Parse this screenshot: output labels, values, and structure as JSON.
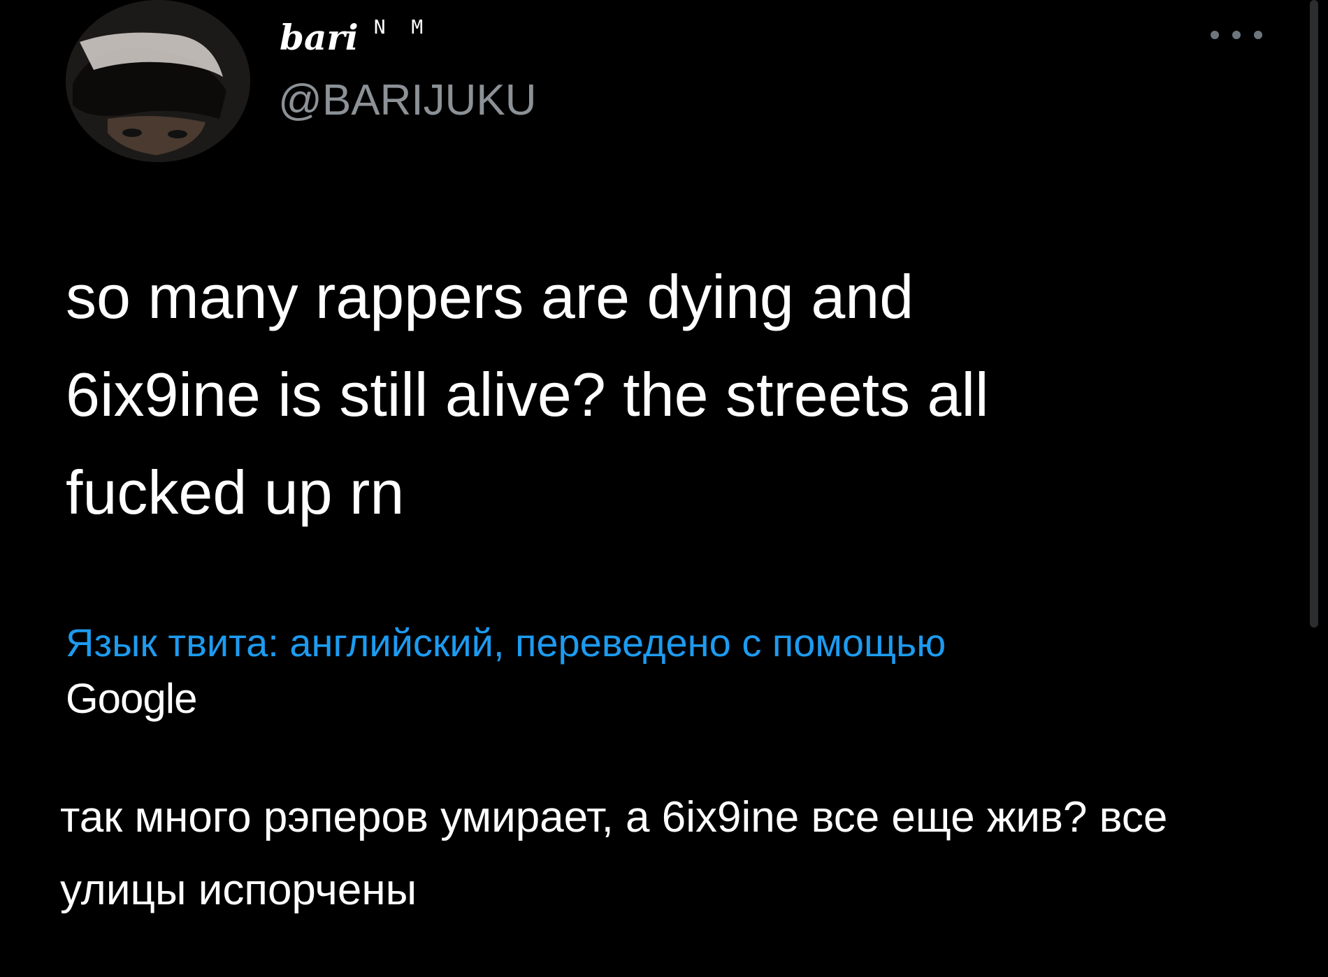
{
  "user": {
    "display_name": "bari",
    "name_suffix": "N M",
    "handle": "@BARIJUKU"
  },
  "menu": {
    "more_icon": "more-horizontal-icon"
  },
  "tweet": {
    "text": "so many rappers are dying and\n6ix9ine is still alive? the streets all\nfucked up rn",
    "translation_note": "Язык твита: английский, переведено с помощью",
    "translation_provider": "Google",
    "translated_text": "так много рэперов умирает, а 6ix9ine все еще жив? все улицы испорчены"
  },
  "colors": {
    "background": "#000000",
    "primary_text": "#ffffff",
    "secondary_text": "#8b9196",
    "link": "#1d9bf0"
  }
}
